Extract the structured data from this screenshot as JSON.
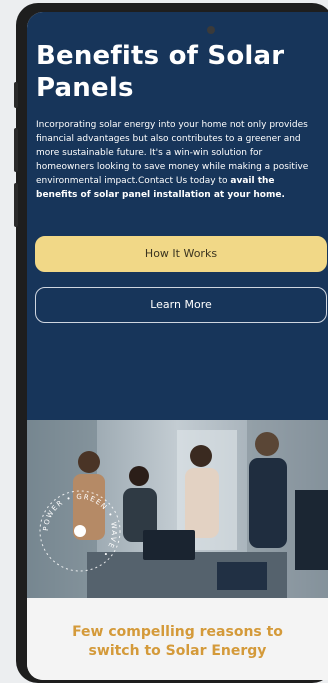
{
  "hero": {
    "title": "Benefits of Solar Panels",
    "description": "Incorporating solar energy into your home not only provides financial advantages but also contributes to a greener and more sustainable future. It's a win-win solution for homeowners looking to save money while making a positive environmental impact.Contact Us today to ",
    "description_bold": "avail the benefits of solar panel installation at your home."
  },
  "buttons": {
    "how_it_works": "How It Works",
    "learn_more": "Learn More"
  },
  "badge": {
    "ring_text": "POWER • GREEN • WAVE •"
  },
  "reasons": {
    "heading": "Few compelling reasons to switch to Solar Energy"
  },
  "colors": {
    "hero_bg": "#17355a",
    "accent_yellow": "#f1d887",
    "heading_orange": "#d49a3a"
  }
}
